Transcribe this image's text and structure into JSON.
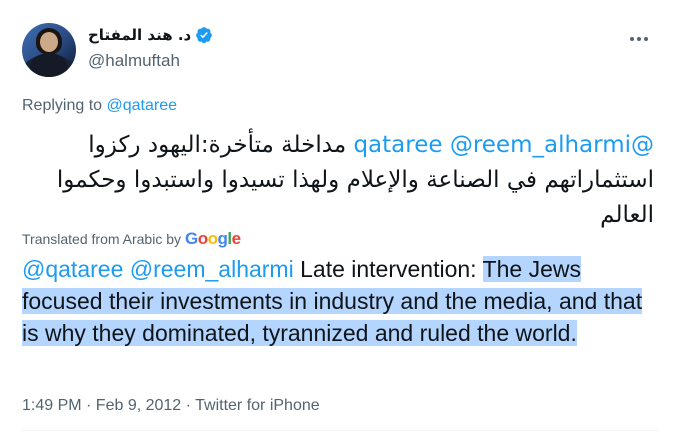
{
  "author": {
    "display_name": "د. هند المفتاح",
    "handle": "@halmuftah"
  },
  "menu": {
    "icon": "more-horizontal-icon"
  },
  "reply": {
    "prefix": "Replying to ",
    "to": "@qataree"
  },
  "tweet": {
    "mention1": "@qataree",
    "mention2": "@reem_alharmi",
    "text_arabic": "مداخلة متأخرة:اليهود ركزوا استثماراتهم في الصناعة والإعلام ولهذا تسيدوا واستبدوا وحكموا العالم"
  },
  "translation": {
    "label": "Translated from Arabic by",
    "provider_letters": [
      "G",
      "o",
      "o",
      "g",
      "l",
      "e"
    ],
    "mention1": "@qataree",
    "mention2": "@reem_alharmi",
    "lead": " Late intervention: ",
    "highlighted": "The Jews focused their investments in industry and the media, and that is why they dominated, tyrannized and ruled the world."
  },
  "meta": {
    "text": "1:49 PM · Feb 9, 2012 · Twitter for iPhone"
  },
  "colors": {
    "link": "#1d9bf0",
    "muted": "#536471",
    "selection": "#b4d5fe"
  }
}
